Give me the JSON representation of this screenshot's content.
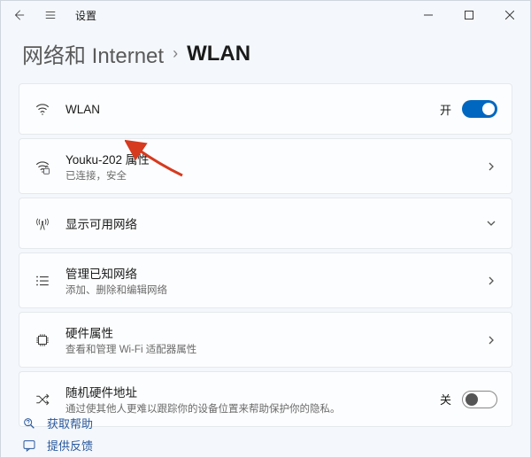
{
  "titlebar": {
    "label": "设置"
  },
  "breadcrumb": {
    "parent": "网络和 Internet",
    "separator": "›",
    "current": "WLAN"
  },
  "rows": {
    "wlan": {
      "title": "WLAN",
      "state_label": "开",
      "toggle_on": true
    },
    "current_network": {
      "title": "Youku-202 属性",
      "subtitle": "已连接，安全"
    },
    "show_networks": {
      "title": "显示可用网络"
    },
    "known_networks": {
      "title": "管理已知网络",
      "subtitle": "添加、删除和编辑网络"
    },
    "hardware": {
      "title": "硬件属性",
      "subtitle": "查看和管理 Wi-Fi 适配器属性"
    },
    "random_mac": {
      "title": "随机硬件地址",
      "subtitle": "通过使其他人更难以跟踪你的设备位置来帮助保护你的隐私。",
      "state_label": "关",
      "toggle_on": false
    }
  },
  "footer": {
    "help": "获取帮助",
    "feedback": "提供反馈"
  },
  "colors": {
    "accent": "#0067c0",
    "arrow": "#d63a1f"
  }
}
